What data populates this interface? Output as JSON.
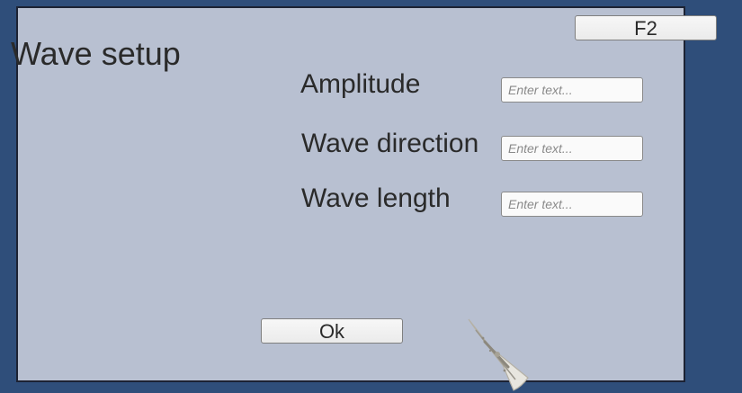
{
  "hotkey_button": {
    "label": "F2"
  },
  "panel": {
    "title": "Wave setup",
    "fields": [
      {
        "label": "Amplitude",
        "value": "",
        "placeholder": "Enter text..."
      },
      {
        "label": "Wave direction",
        "value": "",
        "placeholder": "Enter text..."
      },
      {
        "label": "Wave length",
        "value": "",
        "placeholder": "Enter text..."
      }
    ],
    "ok_button": {
      "label": "Ok"
    }
  },
  "icons": {
    "boat": "boat-icon"
  },
  "colors": {
    "background": "#2f4e7a",
    "panel": "#b8c0d1",
    "panel_border": "#1c2233",
    "text": "#2a2a2a"
  }
}
